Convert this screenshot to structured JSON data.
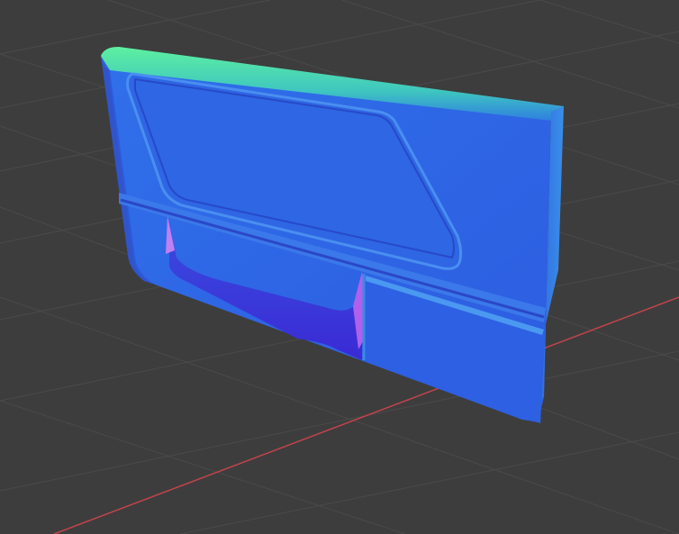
{
  "viewport": {
    "background_color": "#3d3d3d",
    "grid_color": "#4a4a4a",
    "x_axis_color": "#c0444c",
    "shading": "normal-map"
  },
  "model": {
    "name": "",
    "colors": {
      "base": "#2f62e0",
      "edge_top": "#4de0a0",
      "edge_mid": "#3fb6c8",
      "shadow": "#2846c8",
      "recess": "#3a2fd6",
      "accent": "#b85cf0"
    }
  }
}
